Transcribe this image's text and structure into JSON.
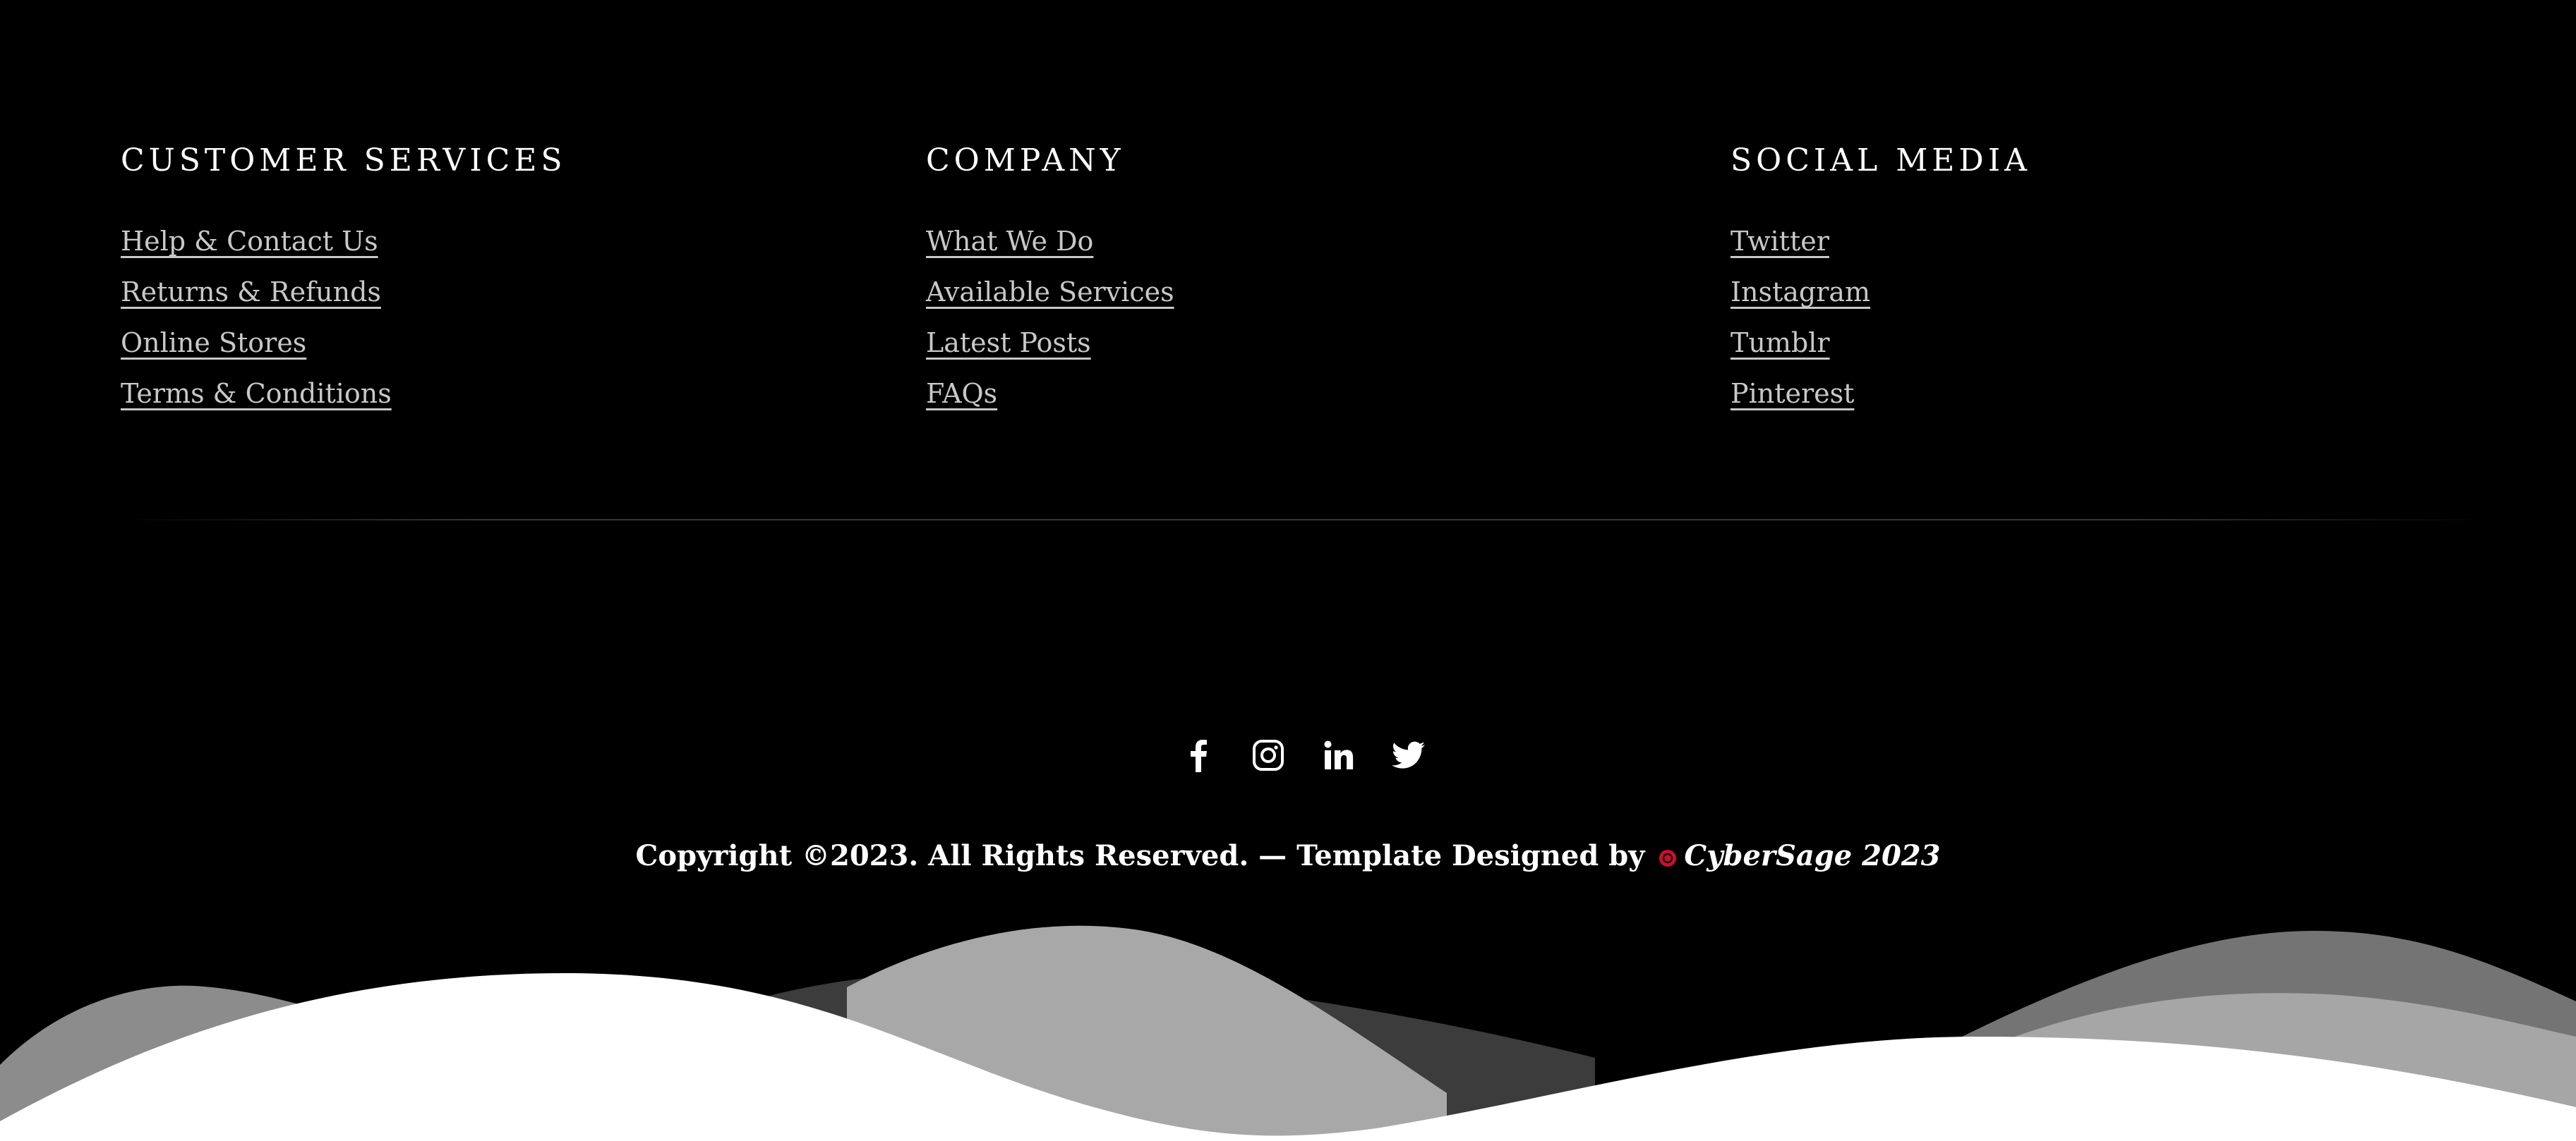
{
  "columns": [
    {
      "title": "CUSTOMER SERVICES",
      "links": [
        "Help & Contact Us",
        "Returns & Refunds",
        "Online Stores",
        "Terms & Conditions"
      ]
    },
    {
      "title": "COMPANY",
      "links": [
        "What We Do",
        "Available Services",
        "Latest Posts",
        "FAQs"
      ]
    },
    {
      "title": "SOCIAL MEDIA",
      "links": [
        "Twitter",
        "Instagram",
        "Tumblr",
        "Pinterest"
      ]
    }
  ],
  "social_icons": [
    "facebook-icon",
    "instagram-icon",
    "linkedin-icon",
    "twitter-icon"
  ],
  "copyright": {
    "text": "Copyright ©2023. All Rights Reserved. — Template Designed by",
    "brand": "CyberSage 2023"
  },
  "colors": {
    "background": "#000000",
    "heading": "#ffffff",
    "link": "#c8c8c8",
    "brand_mark": "#c8102e",
    "wave_front": "#ffffff",
    "wave_mid": "#a6a6a6",
    "wave_back": "#7a7a7a"
  }
}
